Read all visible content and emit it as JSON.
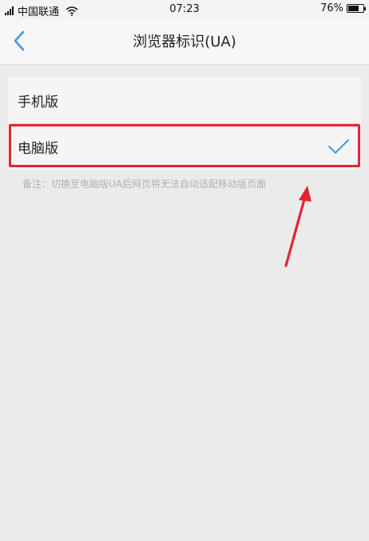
{
  "status_bar": {
    "carrier": "中国联通",
    "time": "07:23",
    "battery": "76%",
    "battery_level": 0.76,
    "icons": [
      "signal-icon",
      "wifi-icon",
      "battery-icon"
    ]
  },
  "nav": {
    "back_icon": "chevron-left-icon",
    "title": "浏览器标识(UA)"
  },
  "options": [
    {
      "label": "手机版",
      "selected": false
    },
    {
      "label": "电脑版",
      "selected": true
    }
  ],
  "note": "备注：切换至电脑版UA后网页将无法自动适配移动版页面",
  "colors": {
    "accent": "#3d9be9",
    "highlight": "#e02633",
    "note_text": "#b0b0b0"
  }
}
